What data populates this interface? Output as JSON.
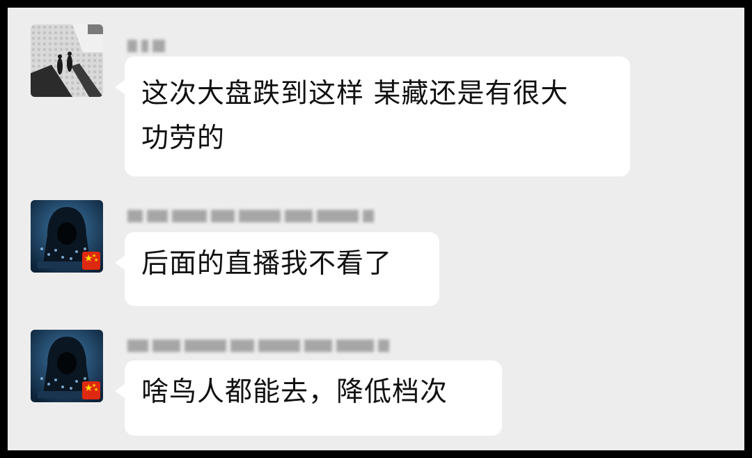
{
  "messages": [
    {
      "avatar_icon": "street-photo-avatar",
      "text": "这次大盘跌到这样 某藏还是有很大功劳的",
      "lines": [
        "这次大盘跌到这样 某藏还是有很大",
        "功劳的"
      ]
    },
    {
      "avatar_icon": "hooded-hacker-avatar",
      "badge_icon": "china-flag-icon",
      "text": "后面的直播我不看了"
    },
    {
      "avatar_icon": "hooded-hacker-avatar",
      "badge_icon": "china-flag-icon",
      "text": "啥鸟人都能去，降低档次"
    }
  ],
  "colors": {
    "chat_background": "#ededed",
    "bubble_background": "#ffffff",
    "frame_border": "#000000",
    "text": "#111111"
  }
}
